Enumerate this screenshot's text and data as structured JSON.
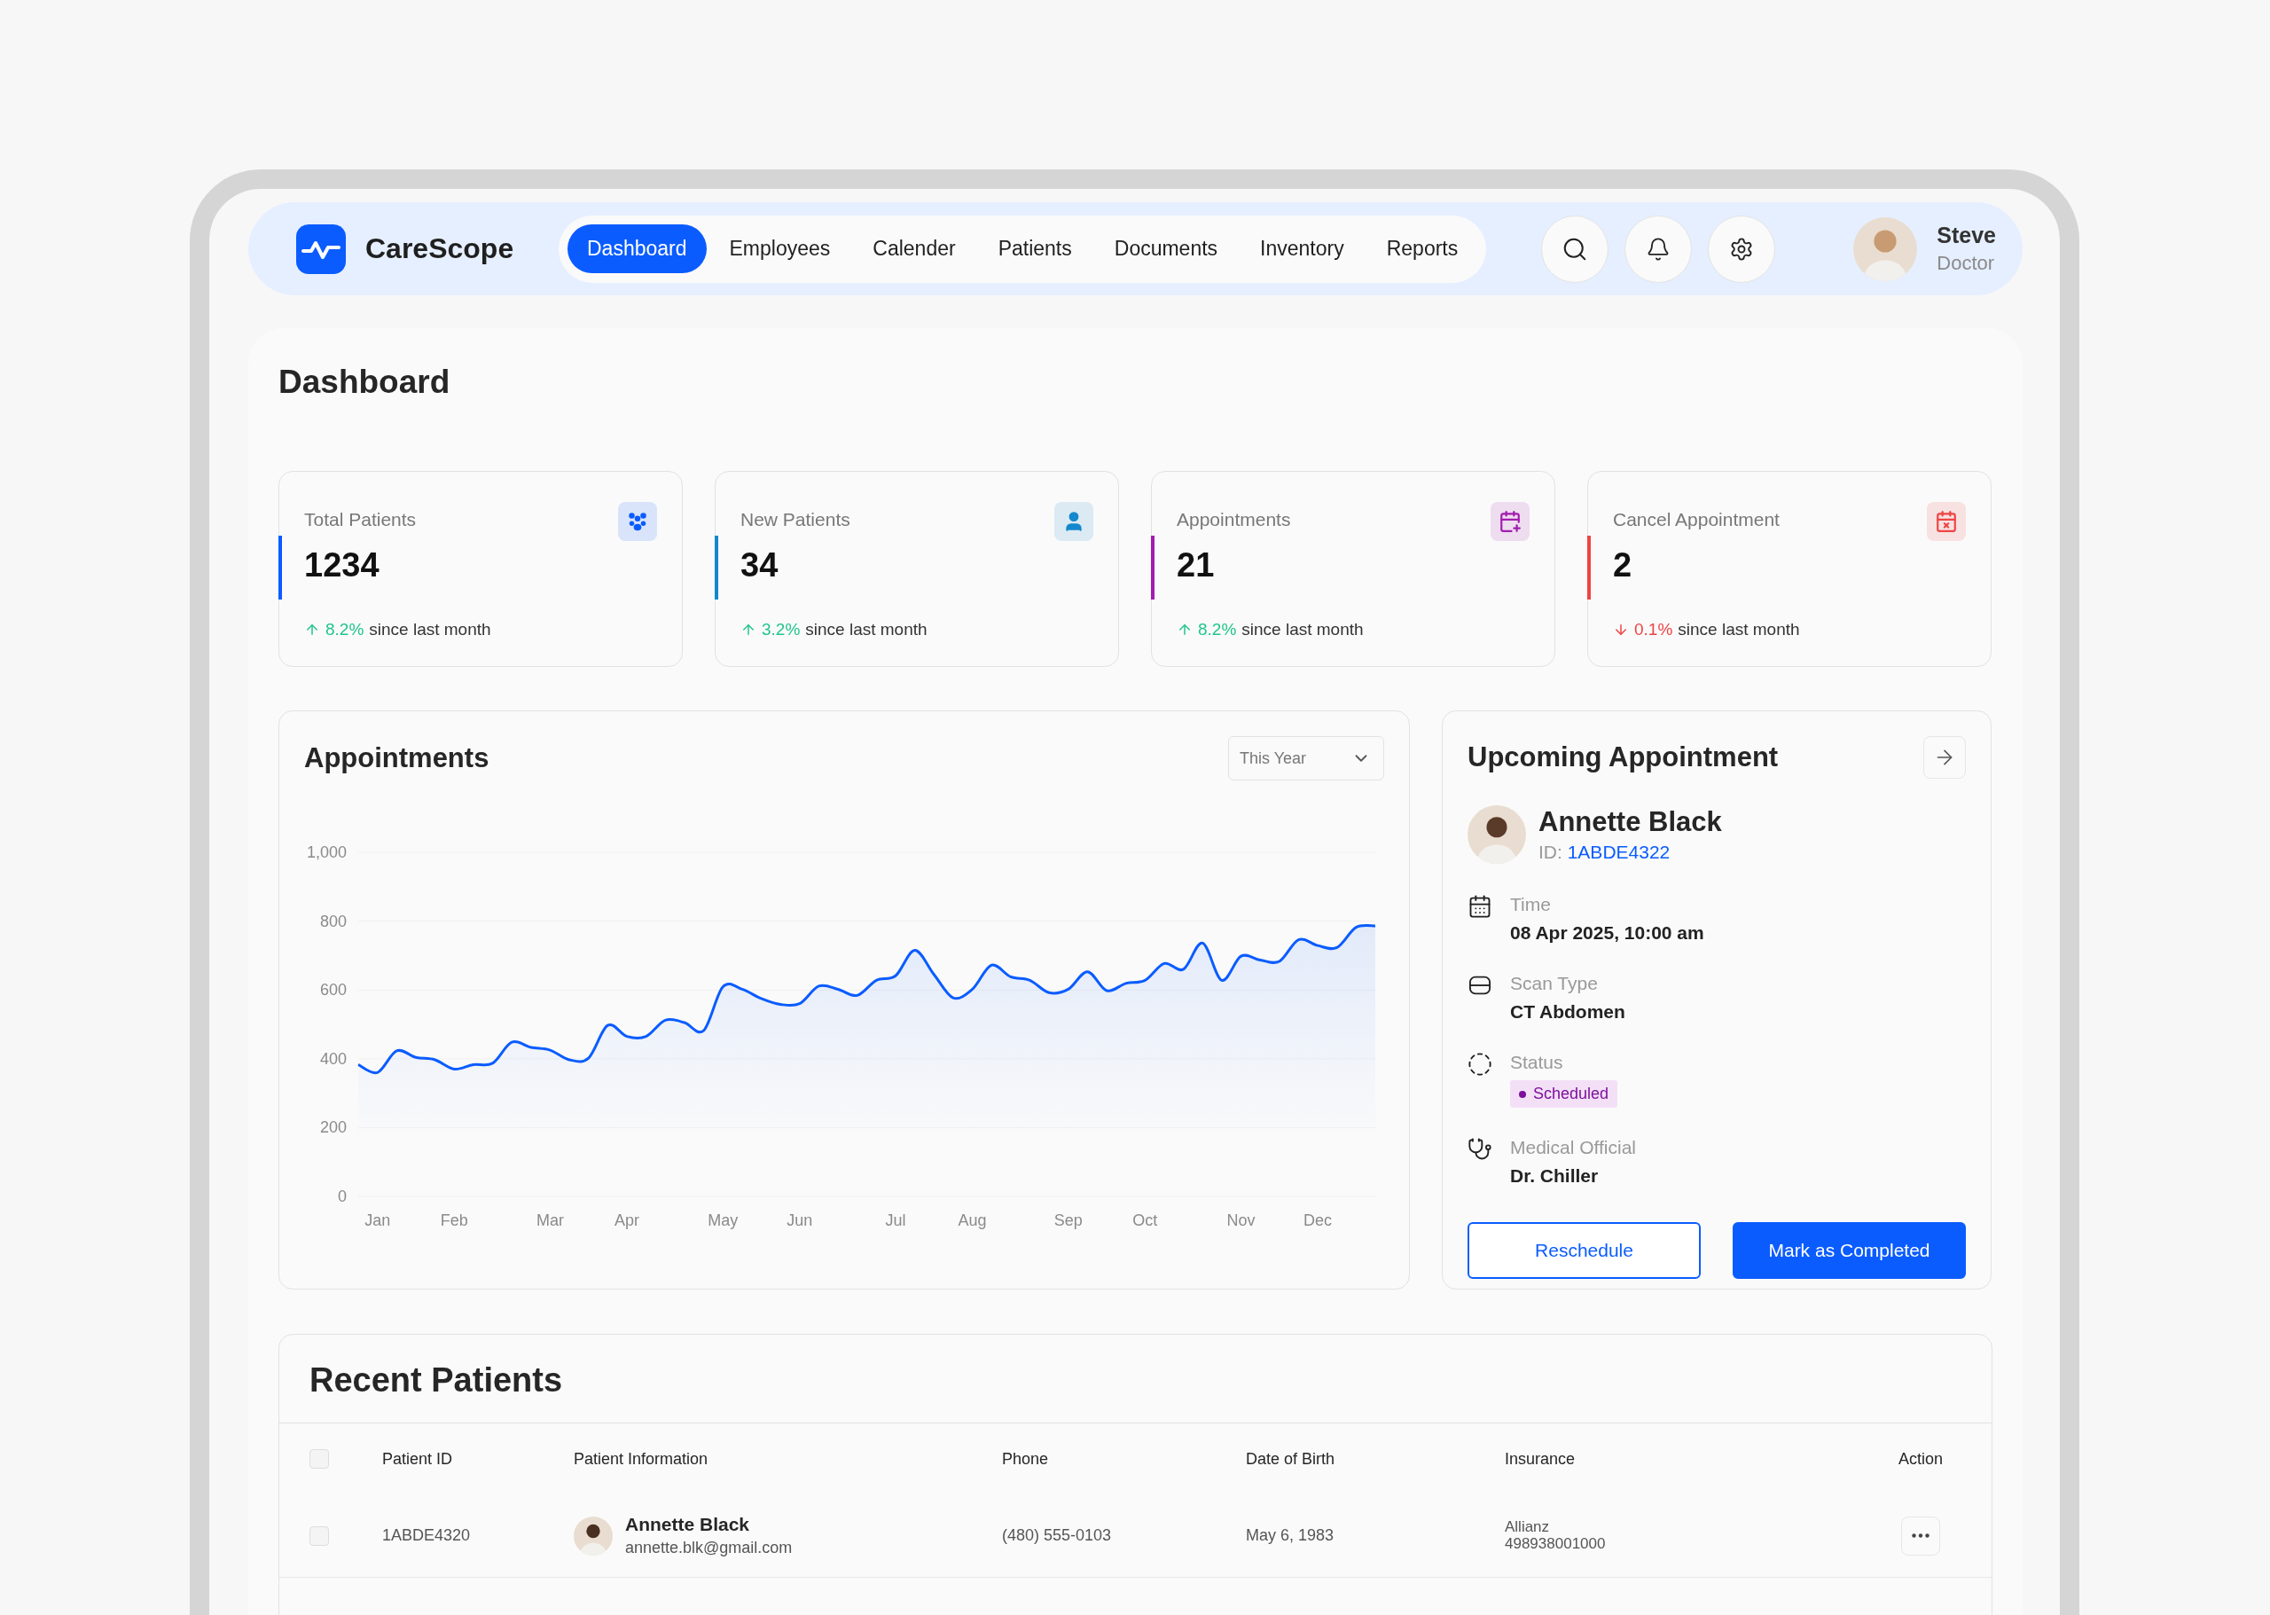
{
  "brand": {
    "name": "CareScope"
  },
  "nav": [
    {
      "label": "Dashboard",
      "selected": true
    },
    {
      "label": "Employees",
      "selected": false
    },
    {
      "label": "Calender",
      "selected": false
    },
    {
      "label": "Patients",
      "selected": false
    },
    {
      "label": "Documents",
      "selected": false
    },
    {
      "label": "Inventory",
      "selected": false
    },
    {
      "label": "Reports",
      "selected": false
    }
  ],
  "header_actions": [
    {
      "kind": "search"
    },
    {
      "kind": "notifications"
    },
    {
      "kind": "settings"
    }
  ],
  "user": {
    "name": "Steve",
    "role": "Doctor"
  },
  "page_title": "Dashboard",
  "stats": [
    {
      "label": "Total Patients",
      "value": "1234",
      "increase": true,
      "change": "8.2%",
      "note": "since last month",
      "color": "#0a5cff"
    },
    {
      "label": "New Patients",
      "value": "34",
      "increase": true,
      "change": "3.2%",
      "note": "since last month",
      "color": "#1488cc"
    },
    {
      "label": "Appointments",
      "value": "21",
      "increase": true,
      "change": "8.2%",
      "note": "since last month",
      "color": "#a21caf"
    },
    {
      "label": "Cancel Appointment",
      "value": "2",
      "increase": false,
      "change": "0.1%",
      "note": "since last month",
      "color": "#ef4444"
    }
  ],
  "appointments_chart": {
    "title": "Appointments",
    "range": "This Year",
    "chart_data": {
      "type": "area",
      "categories": [
        null,
        "Jan",
        null,
        null,
        null,
        "Feb",
        null,
        null,
        null,
        null,
        "Mar",
        null,
        null,
        null,
        "Apr",
        null,
        null,
        null,
        null,
        "May",
        null,
        null,
        null,
        "Jun",
        null,
        null,
        null,
        null,
        "Jul",
        null,
        null,
        null,
        "Aug",
        null,
        null,
        null,
        null,
        "Sep",
        null,
        null,
        null,
        "Oct",
        null,
        null,
        null,
        null,
        "Nov",
        null,
        null,
        null,
        "Dec",
        null,
        null,
        null
      ],
      "series": [
        {
          "color": "#0a5cff",
          "values": [
            383,
            360,
            423,
            404,
            397,
            370,
            383,
            387,
            448,
            433,
            425,
            397,
            402,
            497,
            465,
            465,
            512,
            505,
            482,
            609,
            602,
            575,
            558,
            560,
            611,
            602,
            584,
            628,
            641,
            715,
            645,
            577,
            602,
            672,
            638,
            628,
            592,
            602,
            653,
            598,
            619,
            628,
            677,
            660,
            736,
            628,
            698,
            687,
            683,
            746,
            729,
            723,
            782,
            786
          ]
        }
      ],
      "ylim": [
        0,
        1000
      ],
      "grid": true,
      "yticks": [
        0,
        200,
        400,
        600,
        800,
        {
          "value": 1000,
          "label": "1,000"
        }
      ]
    }
  },
  "upcoming": {
    "title": "Upcoming Appointment",
    "patient": {
      "name": "Annette Black",
      "id_label": "ID:",
      "id": "1ABDE4322"
    },
    "details": [
      {
        "kind": "text",
        "label": "Time",
        "value": "08 Apr 2025, 10:00 am"
      },
      {
        "kind": "text",
        "label": "Scan Type",
        "value": "CT Abdomen"
      },
      {
        "kind": "badge",
        "label": "Status",
        "value": "Scheduled"
      },
      {
        "kind": "text",
        "label": "Medical Official",
        "value": "Dr. Chiller"
      }
    ],
    "buttons": [
      {
        "label": "Reschedule",
        "kind": "outline"
      },
      {
        "label": "Mark as Completed",
        "kind": "primary"
      }
    ]
  },
  "recent_patients": {
    "title": "Recent Patients",
    "select_all_checked": false,
    "columns": [
      "Patient ID",
      "Patient Information",
      "Phone",
      "Date of Birth",
      "Insurance",
      "Action"
    ],
    "rows": [
      {
        "checked": false,
        "patient_id": "1ABDE4320",
        "name": "Annette Black",
        "email": "annette.blk@gmail.com",
        "phone": "(480) 555-0103",
        "dob": "May 6, 1983",
        "insurance": "Allianz",
        "insurance_no": "498938001000"
      }
    ]
  }
}
